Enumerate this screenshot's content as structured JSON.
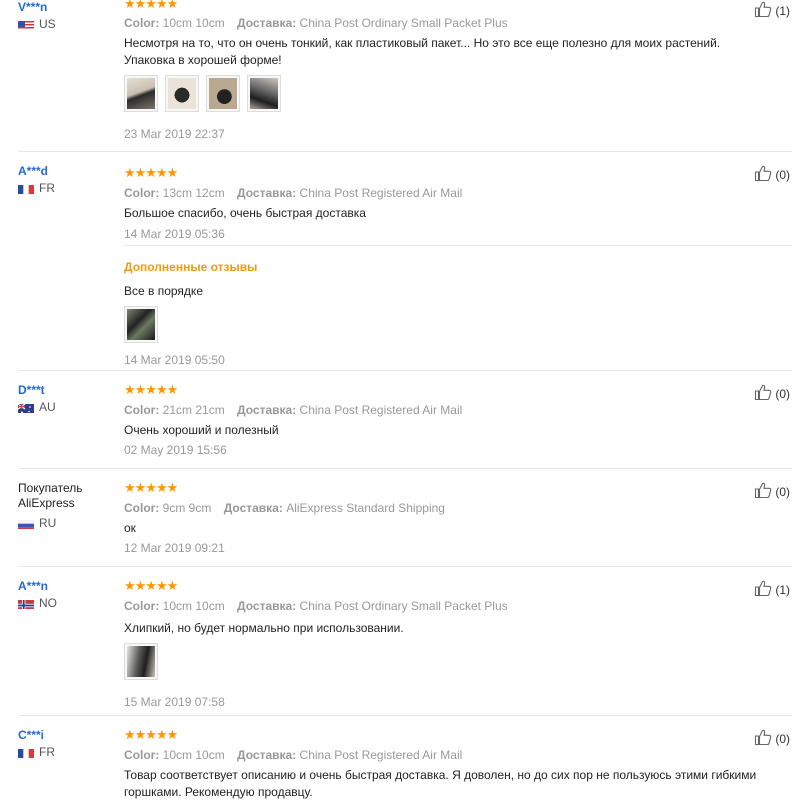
{
  "ui": {
    "color_label": "Color:",
    "delivery_label": "Доставка:",
    "additional_reviews_label": "Дополненные отзывы"
  },
  "reviews": [
    {
      "user": "V***n",
      "country": "US",
      "stars": "★★★★★",
      "color": "10cm 10cm",
      "shipping": "China Post Ordinary Small Packet Plus",
      "text": "Несмотря на то, что он очень тонкий, как пластиковый пакет... Но это все еще полезно для моих растений. Упаковка в хорошей форме!",
      "date": "23 Mar 2019 22:37",
      "likes": "(1)"
    },
    {
      "user": "A***d",
      "country": "FR",
      "stars": "★★★★★",
      "color": "13cm 12cm",
      "shipping": "China Post Registered Air Mail",
      "text": "Большое спасибо, очень быстрая доставка",
      "date": "14 Mar 2019 05:36",
      "likes": "(0)",
      "additional": {
        "text": "Все в порядке",
        "date": "14 Mar 2019 05:50"
      }
    },
    {
      "user": "D***t",
      "country": "AU",
      "stars": "★★★★★",
      "color": "21cm 21cm",
      "shipping": "China Post Registered Air Mail",
      "text": "Очень хороший и полезный",
      "date": "02 May 2019 15:56",
      "likes": "(0)"
    },
    {
      "user": "Покупатель AliExpress",
      "country": "RU",
      "stars": "★★★★★",
      "color": "9cm 9cm",
      "shipping": "AliExpress Standard Shipping",
      "text": "ок",
      "date": "12 Mar 2019 09:21",
      "likes": "(0)"
    },
    {
      "user": "A***n",
      "country": "NO",
      "stars": "★★★★★",
      "color": "10cm 10cm",
      "shipping": "China Post Ordinary Small Packet Plus",
      "text": "Хлипкий, но будет нормально при использовании.",
      "date": "15 Mar 2019 07:58",
      "likes": "(1)"
    },
    {
      "user": "C***i",
      "country": "FR",
      "stars": "★★★★★",
      "color": "10cm 10cm",
      "shipping": "China Post Registered Air Mail",
      "text": "Товар соответствует описанию и очень быстрая доставка. Я доволен, но до сих пор не пользуюсь этими гибкими горшками. Рекомендую продавцу.",
      "date": "",
      "likes": "(0)"
    }
  ]
}
